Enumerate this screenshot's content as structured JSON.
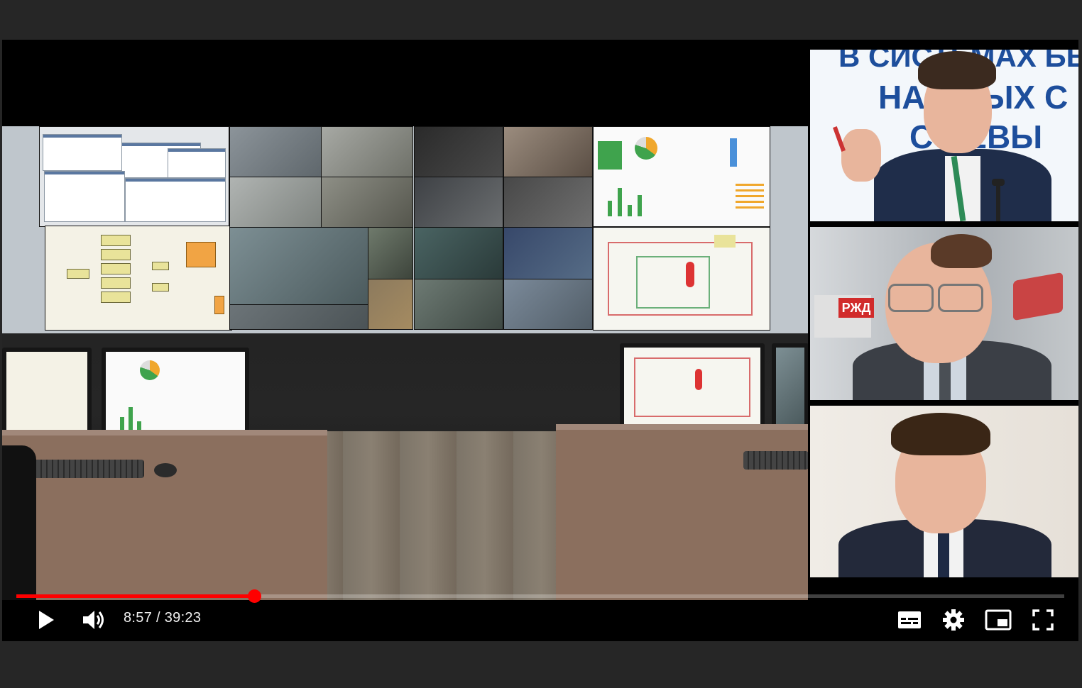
{
  "player": {
    "current_time": "8:57",
    "time_separator": " / ",
    "duration": "39:23",
    "progress": 0.2276,
    "accent_color": "#ff0000"
  },
  "controls": {
    "play_icon": "play-icon",
    "volume_icon": "volume-icon",
    "subtitles_icon": "subtitles-icon",
    "settings_icon": "gear-icon",
    "miniplayer_icon": "miniplayer-icon",
    "fullscreen_icon": "fullscreen-icon"
  },
  "speaker_1": {
    "banner_line_1": "В СИСТЕМАХ БЕЗ",
    "banner_line_2": "НА    ПНЫХ С",
    "banner_line_3": "С    ЛЕВЫ"
  },
  "speaker_2": {
    "sign_text": "РЖД"
  }
}
